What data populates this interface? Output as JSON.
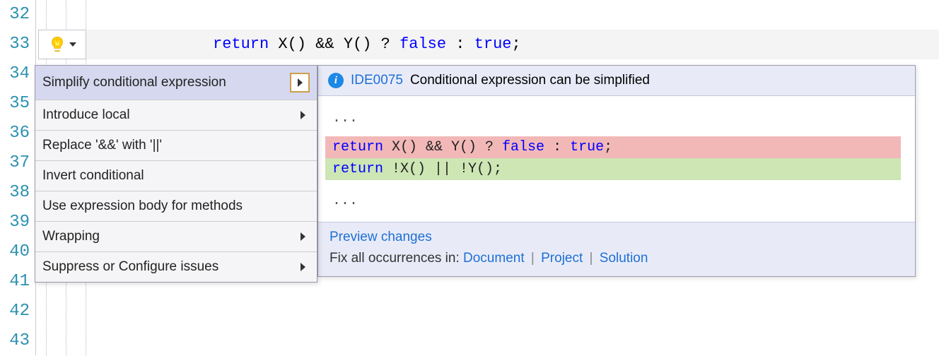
{
  "gutter": {
    "start": 32,
    "end": 43,
    "highlighted": 33
  },
  "code": {
    "tokens": [
      {
        "text": "return",
        "class": "kw"
      },
      {
        "text": " X() && Y() ? ",
        "class": ""
      },
      {
        "text": "false",
        "class": "kw"
      },
      {
        "text": " : ",
        "class": ""
      },
      {
        "text": "true",
        "class": "kw"
      },
      {
        "text": ";",
        "class": ""
      }
    ]
  },
  "actions": [
    {
      "label": "Simplify conditional expression",
      "submenu": true,
      "selected": true
    },
    {
      "label": "Introduce local",
      "submenu": true
    },
    {
      "label": "Replace '&&' with '||'",
      "submenu": false
    },
    {
      "label": "Invert conditional",
      "submenu": false
    },
    {
      "label": "Use expression body for methods",
      "submenu": false
    },
    {
      "label": "Wrapping",
      "submenu": true
    },
    {
      "label": "Suppress or Configure issues",
      "submenu": true
    }
  ],
  "preview": {
    "code_id": "IDE0075",
    "message": "Conditional expression can be simplified",
    "ellipsis": "...",
    "removed": {
      "tokens": [
        {
          "text": "return",
          "class": "kw"
        },
        {
          "text": " X() && Y() ? ",
          "class": ""
        },
        {
          "text": "false",
          "class": "kw"
        },
        {
          "text": " : ",
          "class": ""
        },
        {
          "text": "true",
          "class": "kw"
        },
        {
          "text": ";",
          "class": ""
        }
      ]
    },
    "added": {
      "tokens": [
        {
          "text": "return",
          "class": "kw"
        },
        {
          "text": " !X() || !Y();",
          "class": ""
        }
      ]
    },
    "preview_link": "Preview changes",
    "fix_label": "Fix all occurrences in:",
    "fix_scopes": [
      "Document",
      "Project",
      "Solution"
    ]
  }
}
